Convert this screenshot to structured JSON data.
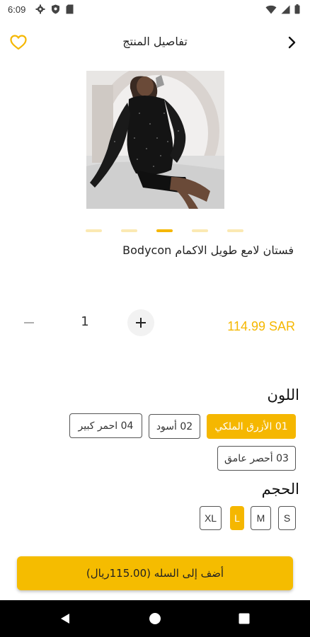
{
  "status_bar": {
    "time": "6:09",
    "left_icons": [
      "gear-icon",
      "shield-icon",
      "sd-card-icon"
    ],
    "right_icons": [
      "wifi-icon",
      "signal-icon",
      "battery-icon"
    ]
  },
  "header": {
    "title": "تفاصيل المنتج",
    "favorite_icon": "heart-outline-icon",
    "back_icon": "chevron-right-icon"
  },
  "product": {
    "name": "فستان لامع طويل الاكمام Bodycon",
    "image_slides": 5,
    "active_slide": 2,
    "price": "114.99 SAR"
  },
  "quantity": {
    "value": "1",
    "minus_icon": "minus-icon",
    "plus_icon": "plus-icon"
  },
  "color_section": {
    "title": "اللون",
    "options": [
      {
        "label": "01 الأزرق الملكي",
        "selected": true
      },
      {
        "label": "02 أسود",
        "selected": false
      },
      {
        "label": "04 احمر كبير",
        "selected": false
      },
      {
        "label": "03 أحصر عامق",
        "selected": false
      }
    ]
  },
  "size_section": {
    "title": "الحجم",
    "options": [
      {
        "label": "S",
        "selected": false
      },
      {
        "label": "M",
        "selected": false
      },
      {
        "label": "L",
        "selected": true
      },
      {
        "label": "XL",
        "selected": false
      }
    ]
  },
  "cart": {
    "button_label": "أضف إلى السله (115.00ريال)"
  },
  "navigation": {
    "icons": [
      "back-triangle-icon",
      "home-circle-icon",
      "recents-square-icon"
    ]
  },
  "colors": {
    "accent": "#f5b700",
    "accent_light": "#fbe9b3",
    "nav_bar": "#000000"
  }
}
